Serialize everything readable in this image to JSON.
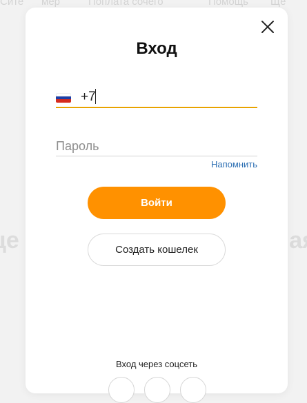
{
  "background": {
    "nav_items": [
      "Сите",
      "мер",
      "Поплата сочего",
      "Помощь",
      "Ще"
    ],
    "heading_left": "це",
    "heading_right": "ая"
  },
  "modal": {
    "title": "Вход",
    "close_icon": "close-icon",
    "phone": {
      "country_flag": "russia-flag-icon",
      "value": "+7"
    },
    "password": {
      "placeholder": "Пароль"
    },
    "remind_link": "Напомнить",
    "login_button": "Войти",
    "create_wallet_button": "Создать кошелек",
    "social_label": "Вход через соцсеть"
  },
  "colors": {
    "accent": "#ff9100",
    "input_focus_underline": "#e8a300",
    "link": "#2d6fb3"
  }
}
